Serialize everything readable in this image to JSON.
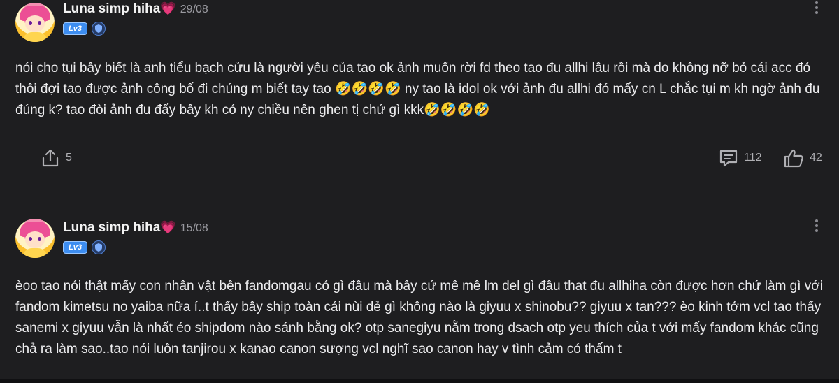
{
  "posts": [
    {
      "username": "Luna simp hiha",
      "heart": "💗",
      "date": "29/08",
      "level": "Lv3",
      "content": "nói cho tụi bây biết là anh tiểu bạch cửu là người yêu của tao ok ảnh muốn rời fd theo tao đu allhi lâu rồi mà do không nỡ bỏ cái acc đó thôi đợi tao được ảnh công bố đi chúng m biết tay tao 🤣🤣🤣🤣 ny tao là idol ok với ảnh đu allhi đó mấy cn L chắc tụi m kh ngờ ảnh đu đúng k? tao đòi ảnh đu đấy bây kh có ny chiều nên ghen tị chứ gì kkk🤣🤣🤣🤣",
      "shares": "5",
      "comments": "112",
      "likes": "42"
    },
    {
      "username": "Luna simp hiha",
      "heart": "💗",
      "date": "15/08",
      "level": "Lv3",
      "content": "èoo tao nói thật mấy con nhân vật bên fandomgau có gì đâu mà bây cứ mê mê lm del gì đâu that đu allhiha còn được hơn chứ làm gì với fandom kimetsu no yaiba nữa í..t thấy bây ship toàn cái nùi dẻ gì không nào là giyuu x shinobu?? giyuu x tan??? èo kinh tởm vcl tao thấy sanemi x giyuu vẫn là nhất éo shipdom nào sánh bằng ok? otp sanegiyu nằm trong dsach otp yeu thích của t với mấy fandom khác cũng chả ra làm sao..tao nói luôn tanjirou x kanao canon sượng vcl nghĩ sao canon hay v tình cảm có thấm t"
    }
  ],
  "icons": {
    "share": "share-icon",
    "comment": "comment-icon",
    "like": "like-icon",
    "more": "more-vertical-icon",
    "badge": "shield-badge-icon"
  },
  "colors": {
    "background": "#1e1e20",
    "level_badge": "#3d8df0",
    "heart": "#f06bd3"
  }
}
